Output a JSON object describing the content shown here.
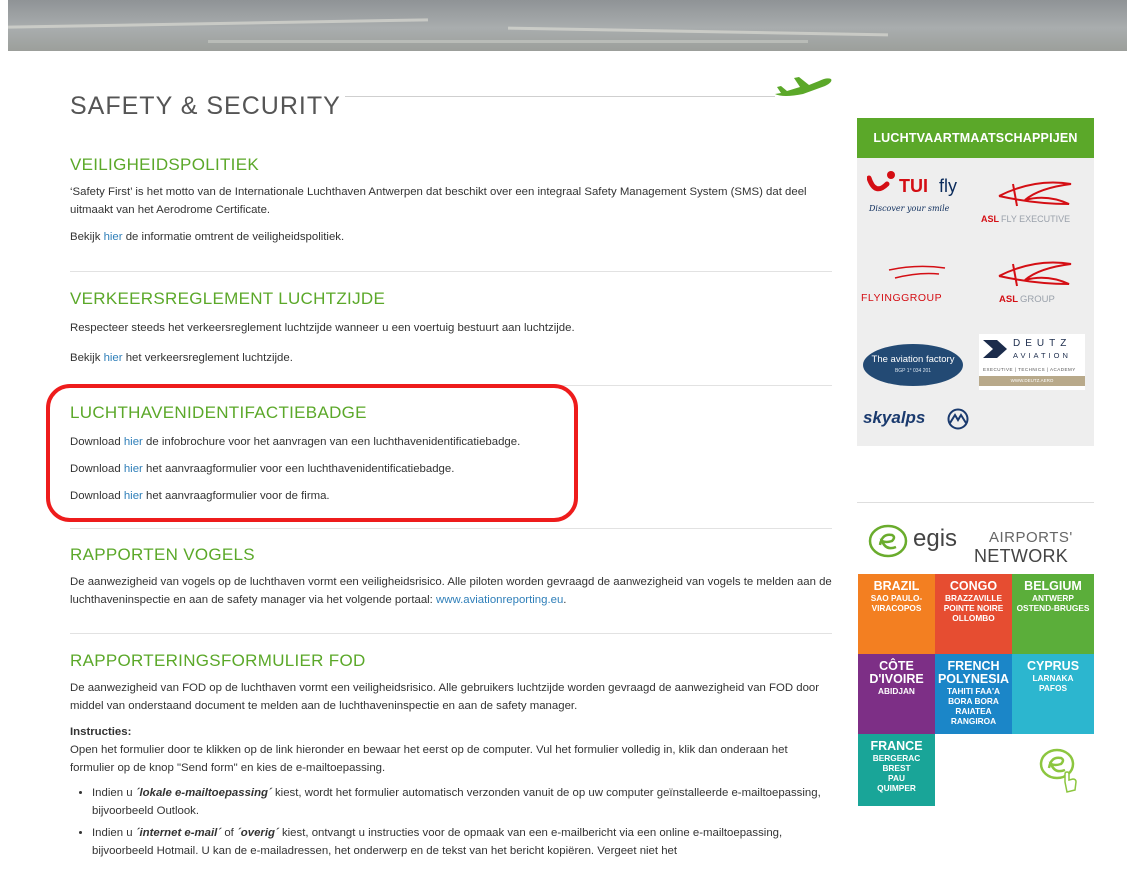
{
  "page": {
    "title": "SAFETY & SECURITY"
  },
  "sections": [
    {
      "heading": "VEILIGHEIDSPOLITIEK",
      "para1": "‘Safety First’ is het motto van de Internationale Luchthaven Antwerpen dat beschikt over een integraal Safety Management System (SMS) dat deel uitmaakt van het Aerodrome Certificate.",
      "line_pre": "Bekijk ",
      "link": "hier",
      "line_post": " de informatie omtrent de veiligheidspolitiek."
    },
    {
      "heading": "VERKEERSREGLEMENT LUCHTZIJDE",
      "para1": "Respecteer steeds het verkeersreglement luchtzijde wanneer u een voertuig bestuurt aan luchtzijde.",
      "line_pre": "Bekijk ",
      "link": "hier",
      "line_post": " het verkeersreglement luchtzijde."
    },
    {
      "heading": "LUCHTHAVENIDENTIFACTIEBADGE",
      "lines": [
        {
          "pre": "Download ",
          "link": "hier",
          "post": " de infobrochure voor het aanvragen van een luchthavenidentificatiebadge."
        },
        {
          "pre": "Download ",
          "link": "hier",
          "post": " het aanvraagformulier voor een luchthavenidentificatiebadge."
        },
        {
          "pre": "Download ",
          "link": "hier",
          "post": " het aanvraagformulier voor de firma."
        }
      ]
    },
    {
      "heading": "RAPPORTEN VOGELS",
      "para_pre": "De aanwezigheid van vogels op de luchthaven vormt een veiligheidsrisico. Alle piloten worden gevraagd de aanwezigheid van vogels te melden aan de luchthaveninspectie en aan de safety manager via het volgende portaal: ",
      "link": "www.aviationreporting.eu",
      "para_post": "."
    },
    {
      "heading": "RAPPORTERINGSFORMULIER FOD",
      "para1": "De aanwezigheid van FOD op de luchthaven vormt een veiligheidsrisico.  Alle gebruikers luchtzijde worden gevraagd de aanwezigheid van FOD door middel van onderstaand document te melden aan de luchthaveninspectie en aan de safety manager.",
      "instr_title": "Instructies:",
      "instr_text": "Open het formulier door te klikken op de link hieronder en bewaar het eerst op de computer. Vul het formulier volledig in, klik dan onderaan het formulier op de knop \"Send form\" en kies de e-mailtoepassing.",
      "bullet1_pre": "Indien u ",
      "bullet1_em": "´lokale e-mailtoepassing´",
      "bullet1_post": "kiest, wordt het formulier automatisch verzonden vanuit de op uw computer geïnstalleerde e-mailtoepassing, bijvoorbeeld Outlook.",
      "bullet2_pre": "Indien u ",
      "bullet2_em1": "´internet e-mail´",
      "bullet2_mid": "of ",
      "bullet2_em2": "´overig´",
      "bullet2_post": "kiest, ontvangt u instructies voor de opmaak van een e-mailbericht via een online e-mailtoepassing, bijvoorbeeld Hotmail. U kan de e-mailadressen, het onderwerp en de tekst van het bericht kopiëren. Vergeet niet het"
    }
  ],
  "sidebar": {
    "airlines_title": "LUCHTVAARTMAATSCHAPPIJEN",
    "logos": {
      "tui_name": "TUI",
      "tui_fly": "fly",
      "tui_tag": "Discover your smile",
      "asl_fly_a": "ASL",
      "asl_fly_b": " FLY EXECUTIVE",
      "flyinggroup": "FLYINGGROUP",
      "asl_group_a": "ASL",
      "asl_group_b": " GROUP",
      "aviation_factory": "The aviation factory",
      "aviation_factory_sub": "BGP 1° 034 201",
      "deutz_name": "DEUTZ",
      "deutz_sub": "AVIATION",
      "deutz_small": "EXECUTIVE | TECHNICS | ACADEMY",
      "deutz_url": "WWW.DEUTZ.AERO",
      "skyalps": "skyalps"
    },
    "egis": {
      "brand": "egis",
      "airports": "AIRPORTS'",
      "network": "NETWORK",
      "tiles": [
        {
          "country": "BRAZIL",
          "cities": "SAO PAULO-\nVIRACOPOS",
          "color": "#f37f21"
        },
        {
          "country": "CONGO",
          "cities": "BRAZZAVILLE\nPOINTE NOIRE\nOLLOMBO",
          "color": "#e64d31"
        },
        {
          "country": "BELGIUM",
          "cities": "ANTWERP\nOSTEND-BRUGES",
          "color": "#5bae3a"
        },
        {
          "country": "CÔTE\nD'IVOIRE",
          "cities": "ABIDJAN",
          "color": "#7d2f86"
        },
        {
          "country": "FRENCH\nPOLYNESIA",
          "cities": "TAHITI FAA'A\nBORA BORA\nRAIATEA\nRANGIROA",
          "color": "#1b86c8"
        },
        {
          "country": "CYPRUS",
          "cities": "LARNAKA\nPAFOS",
          "color": "#2cb6cf"
        },
        {
          "country": "FRANCE",
          "cities": "BERGERAC\nBREST\nPAU\nQUIMPER",
          "color": "#19a598"
        }
      ]
    }
  },
  "colors": {
    "accent_green": "#5ba829",
    "link_blue": "#2f7fb9",
    "highlight_red": "#ee1c1c"
  }
}
